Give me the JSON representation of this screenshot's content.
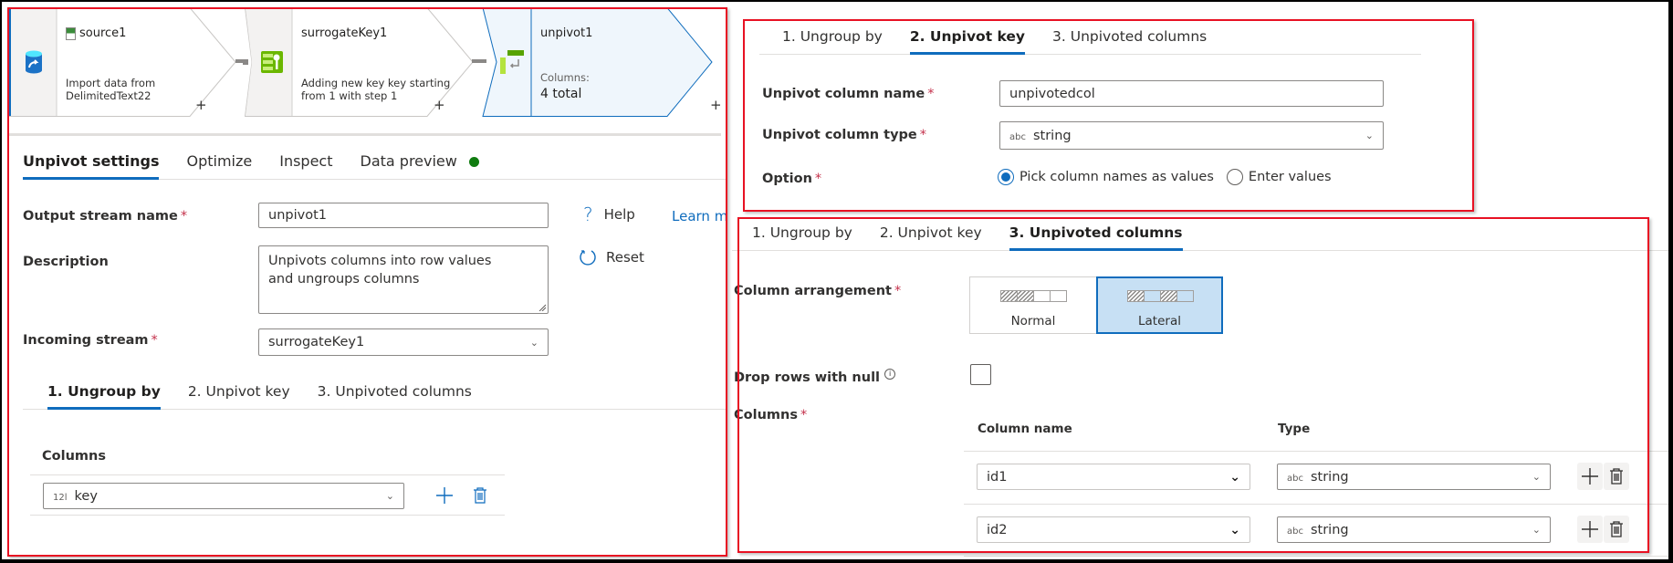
{
  "pipeline": {
    "nodes": [
      {
        "title": "source1",
        "description_line1": "Import data from",
        "description_line2": "DelimitedText22",
        "icon": "database-import-icon",
        "title_icon": "csv-file-icon"
      },
      {
        "title": "surrogateKey1",
        "description_line1": "Adding new key key starting",
        "description_line2": "from 1 with step 1",
        "icon": "surrogate-key-icon"
      },
      {
        "title": "unpivot1",
        "description_line1": "Columns:",
        "description_line2": "4 total",
        "icon": "unpivot-icon"
      }
    ],
    "add_label": "+"
  },
  "settings": {
    "tabs": [
      "Unpivot settings",
      "Optimize",
      "Inspect",
      "Data preview"
    ],
    "active_tab": "Unpivot settings",
    "data_preview_status_color": "#107c10",
    "output_stream_label": "Output stream name",
    "output_stream_value": "unpivot1",
    "description_label": "Description",
    "description_value": "Unpivots columns into row values and ungroups columns",
    "incoming_stream_label": "Incoming stream",
    "incoming_stream_value": "surrogateKey1",
    "help_label": "Help",
    "learn_more_label": "Learn more",
    "reset_label": "Reset",
    "required_mark": "*"
  },
  "steps": {
    "tabs": [
      "1. Ungroup by",
      "2. Unpivot key",
      "3. Unpivoted columns"
    ]
  },
  "ungroup_by": {
    "columns_label": "Columns",
    "rows": [
      {
        "type_tag": "12l",
        "value": "key"
      }
    ]
  },
  "unpivot_key": {
    "column_name_label": "Unpivot column name",
    "column_name_value": "unpivotedcol",
    "column_type_label": "Unpivot column type",
    "column_type_tag": "abc",
    "column_type_value": "string",
    "option_label": "Option",
    "options": [
      "Pick column names as values",
      "Enter values"
    ],
    "selected_option": "Pick column names as values"
  },
  "unpivoted_columns": {
    "arrangement_label": "Column arrangement",
    "arrangements": [
      "Normal",
      "Lateral"
    ],
    "selected_arrangement": "Lateral",
    "drop_null_label": "Drop rows with null",
    "drop_null_checked": false,
    "columns_label": "Columns",
    "headers": [
      "Column name",
      "Type"
    ],
    "rows": [
      {
        "name": "id1",
        "type_tag": "abc",
        "type": "string"
      },
      {
        "name": "id2",
        "type_tag": "abc",
        "type": "string"
      }
    ]
  },
  "colors": {
    "accent": "#0f6cbd",
    "annotation": "#e81123",
    "selected_node_bg": "#eff6fc"
  }
}
